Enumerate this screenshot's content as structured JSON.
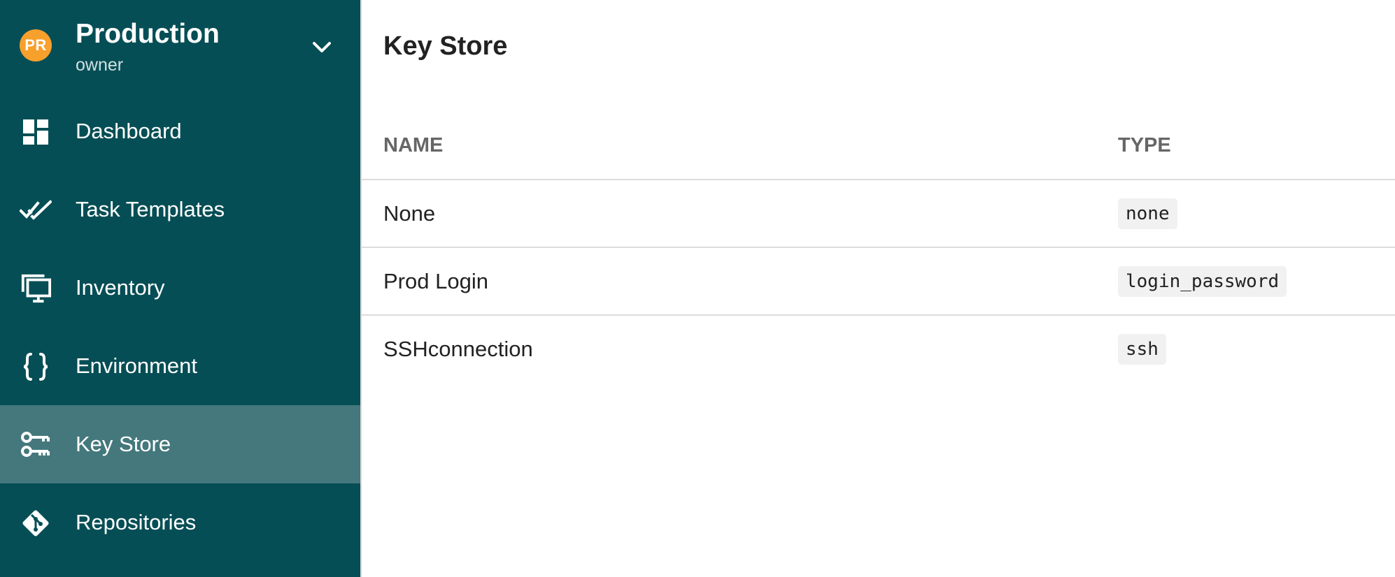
{
  "project": {
    "initials": "PR",
    "name": "Production",
    "role": "owner",
    "avatar_color": "#f7a02c"
  },
  "sidebar": {
    "background": "#064e55",
    "active_background": "#44787c",
    "items": [
      {
        "label": "Dashboard",
        "icon": "dashboard-icon",
        "active": false
      },
      {
        "label": "Task Templates",
        "icon": "double-check-icon",
        "active": false
      },
      {
        "label": "Inventory",
        "icon": "monitor-icon",
        "active": false
      },
      {
        "label": "Environment",
        "icon": "braces-icon",
        "active": false
      },
      {
        "label": "Key Store",
        "icon": "keys-icon",
        "active": true
      },
      {
        "label": "Repositories",
        "icon": "git-icon",
        "active": false
      }
    ]
  },
  "main": {
    "title": "Key Store",
    "columns": [
      "NAME",
      "TYPE"
    ],
    "rows": [
      {
        "name": "None",
        "type": "none"
      },
      {
        "name": "Prod Login",
        "type": "login_password"
      },
      {
        "name": "SSHconnection",
        "type": "ssh"
      }
    ]
  }
}
